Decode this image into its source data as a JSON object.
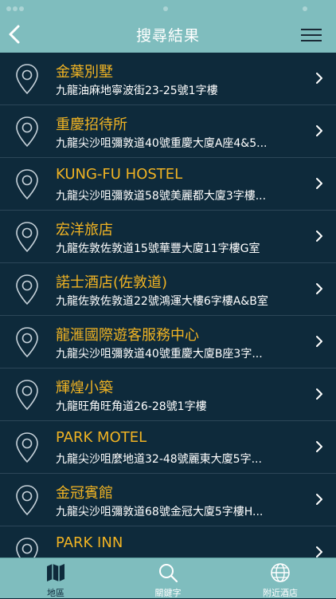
{
  "header": {
    "title": "搜尋結果",
    "back_icon": "chevron-left-icon",
    "menu_icon": "hamburger-menu-icon"
  },
  "results": [
    {
      "name": "金葉別墅",
      "address": "九龍油麻地寧波街23-25號1字樓"
    },
    {
      "name": "重慶招待所",
      "address": "九龍尖沙咀彌敦道40號重慶大廈A座4&5..."
    },
    {
      "name": "KUNG-FU HOSTEL",
      "address": "九龍尖沙咀彌敦道58號美麗都大廈3字樓..."
    },
    {
      "name": "宏洋旅店",
      "address": "九龍佐敦佐敦道15號華豐大廈11字樓G室"
    },
    {
      "name": "諾士酒店(佐敦道)",
      "address": "九龍佐敦佐敦道22號鴻運大樓6字樓A&B室"
    },
    {
      "name": "龍滙國際遊客服務中心",
      "address": "九龍尖沙咀彌敦道40號重慶大廈B座3字..."
    },
    {
      "name": "輝煌小築",
      "address": "九龍旺角旺角道26-28號1字樓"
    },
    {
      "name": "PARK MOTEL",
      "address": "九龍尖沙咀麼地道32-48號麗東大廈5字..."
    },
    {
      "name": "金冠賓館",
      "address": "九龍尖沙咀彌敦道68號金冠大廈5字樓H..."
    },
    {
      "name": "PARK INN",
      "address": ""
    }
  ],
  "tabs": [
    {
      "label": "地區",
      "icon": "map-icon",
      "active": true
    },
    {
      "label": "關鍵字",
      "icon": "search-icon",
      "active": false
    },
    {
      "label": "附近酒店",
      "icon": "globe-icon",
      "active": false
    }
  ],
  "colors": {
    "header_bg": "#7fbdbe",
    "list_bg": "#0e2a3b",
    "name_color": "#f0b323",
    "address_color": "#ffffff"
  }
}
